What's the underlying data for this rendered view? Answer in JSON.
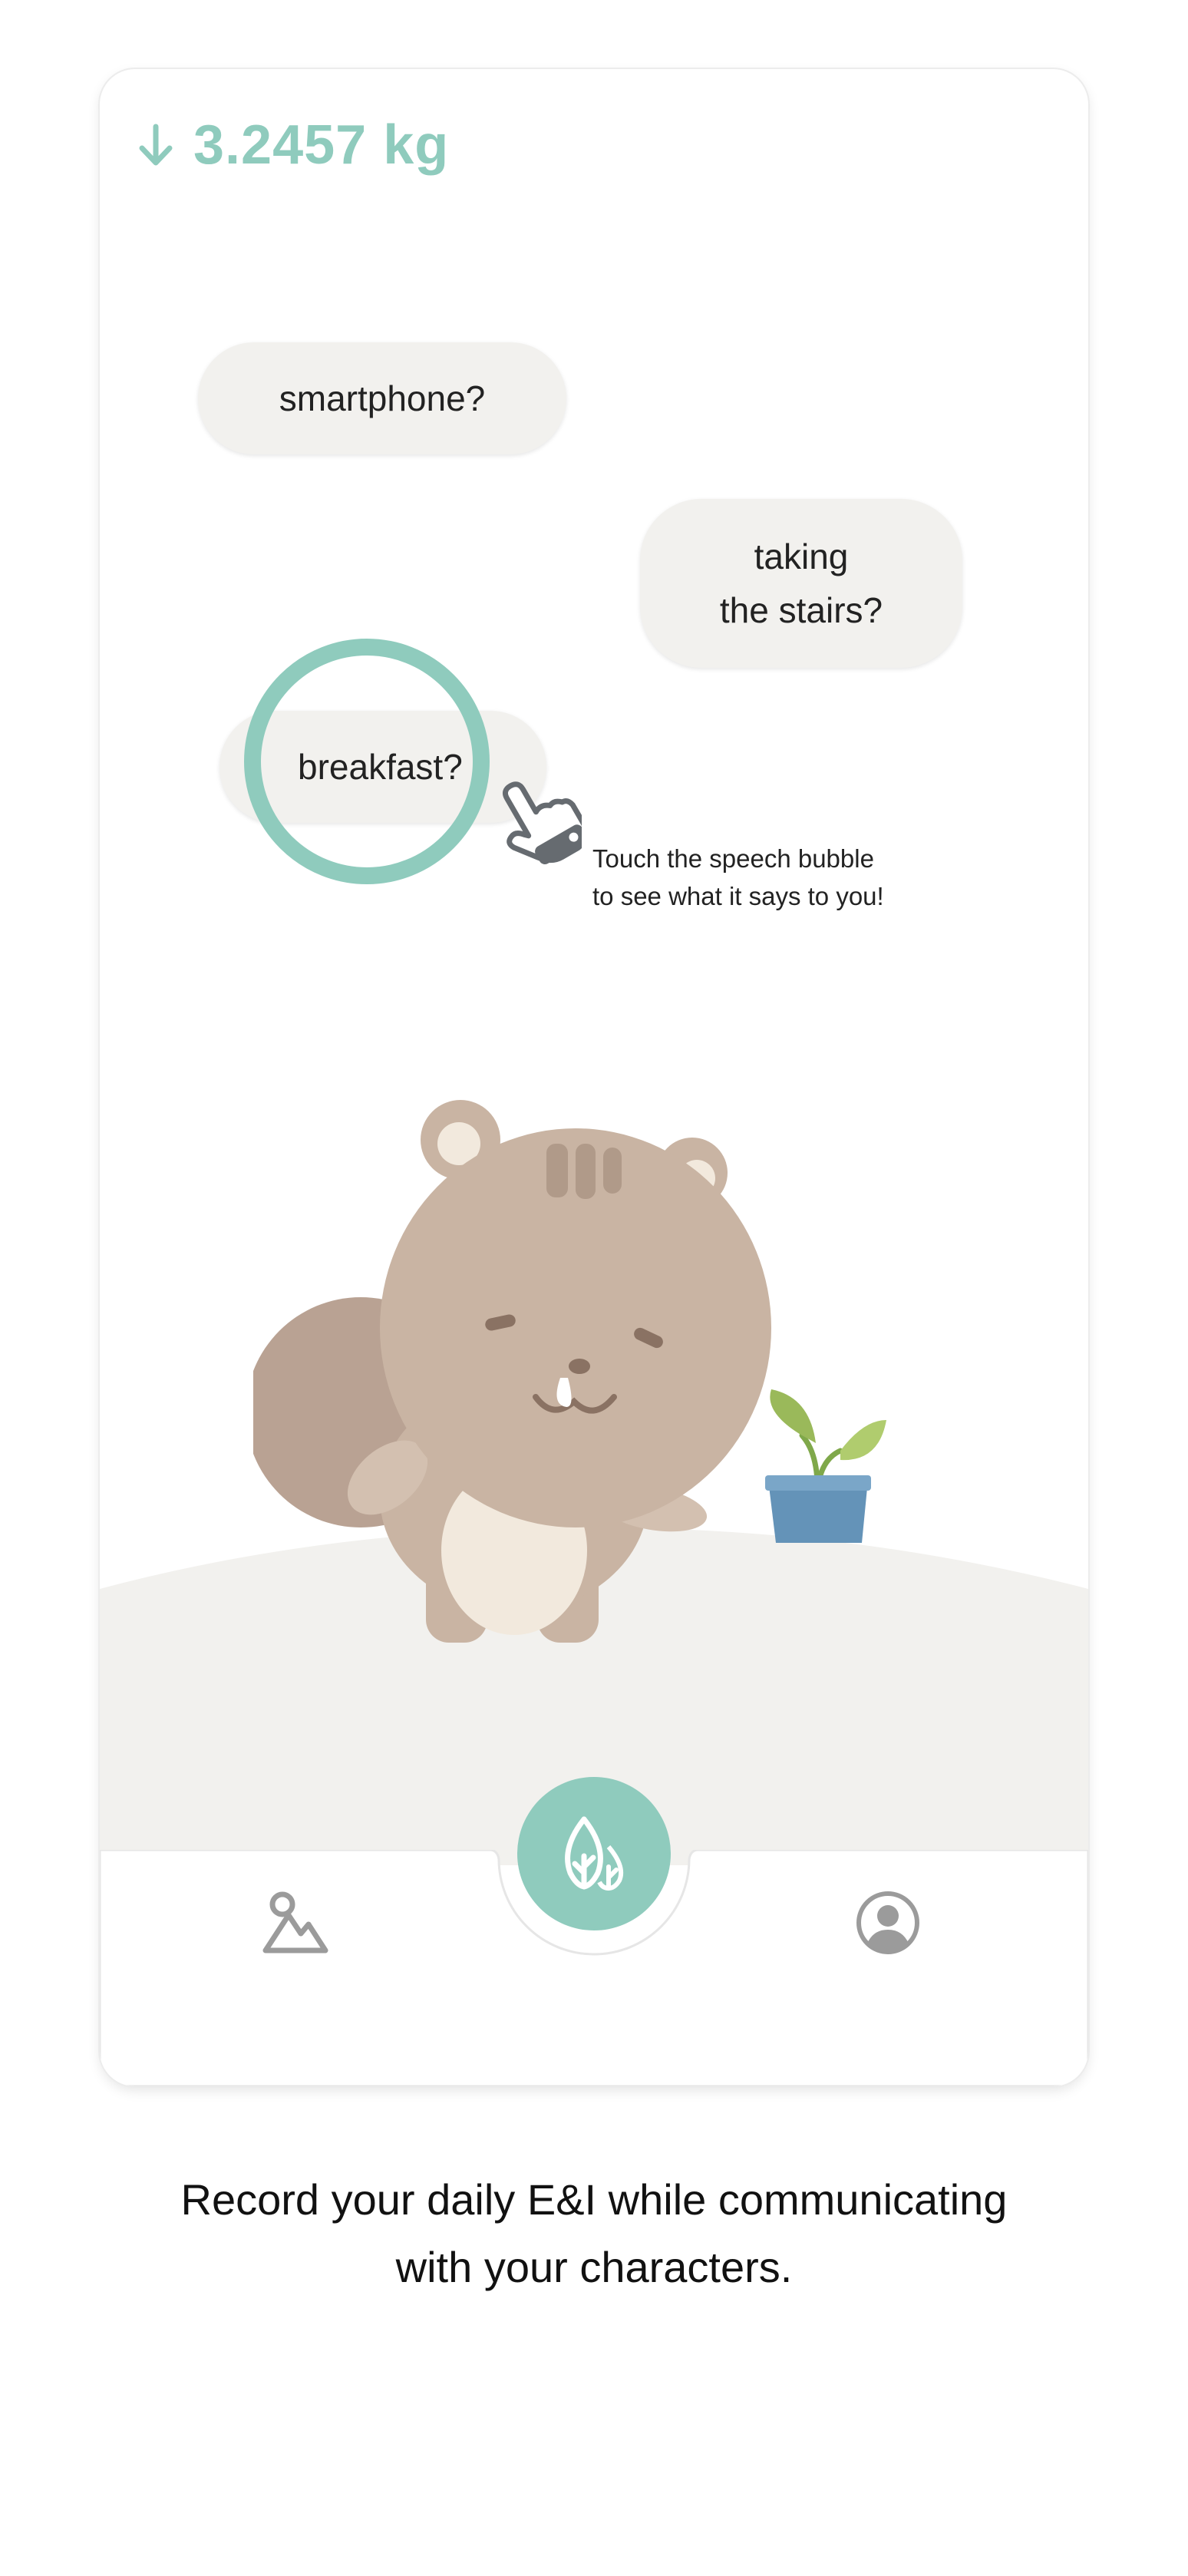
{
  "status": {
    "direction_icon": "arrow-down-icon",
    "value": "3.2457 kg",
    "accent_color": "#8fcbbd"
  },
  "bubbles": [
    {
      "label": "smartphone?"
    },
    {
      "label": "taking\nthe stairs?"
    },
    {
      "label": "breakfast?"
    }
  ],
  "hint": {
    "text": "Touch the speech bubble\nto see what it says to you!",
    "icon": "tap-hand-icon"
  },
  "scene": {
    "character": "squirrel-character",
    "prop": "potted-plant",
    "colors": {
      "fur": "#c9b4a3",
      "ground": "#f2f1ee",
      "pot": "#6493b8",
      "leaf": "#9cc363"
    }
  },
  "tabbar": {
    "items": [
      {
        "icon": "mountain-image-icon"
      },
      {
        "icon": "leaves-icon"
      },
      {
        "icon": "user-profile-icon"
      }
    ]
  },
  "caption": "Record your daily E&I while communicating\nwith your characters."
}
